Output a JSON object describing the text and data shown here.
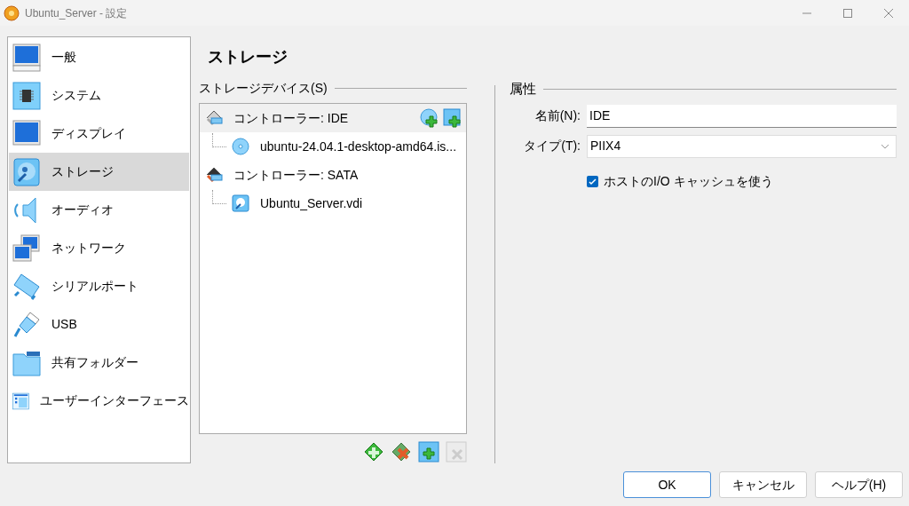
{
  "window": {
    "title": "Ubuntu_Server - 設定"
  },
  "sidebar": {
    "items": [
      {
        "label": "一般",
        "kind": "general",
        "selected": false
      },
      {
        "label": "システム",
        "kind": "system",
        "selected": false
      },
      {
        "label": "ディスプレイ",
        "kind": "display",
        "selected": false
      },
      {
        "label": "ストレージ",
        "kind": "storage",
        "selected": true
      },
      {
        "label": "オーディオ",
        "kind": "audio",
        "selected": false
      },
      {
        "label": "ネットワーク",
        "kind": "network",
        "selected": false
      },
      {
        "label": "シリアルポート",
        "kind": "serial",
        "selected": false
      },
      {
        "label": "USB",
        "kind": "usb",
        "selected": false
      },
      {
        "label": "共有フォルダー",
        "kind": "folder",
        "selected": false
      },
      {
        "label": "ユーザーインターフェース",
        "kind": "ui",
        "selected": false
      }
    ]
  },
  "page": {
    "title": "ストレージ"
  },
  "storage": {
    "group_label": "ストレージデバイス(S)",
    "tree": [
      {
        "kind": "controller",
        "label": "コントローラー: IDE",
        "selected": true,
        "children": [
          {
            "kind": "optical",
            "label": "ubuntu-24.04.1-desktop-amd64.is...",
            "selected": false
          }
        ]
      },
      {
        "kind": "controller",
        "label": "コントローラー: SATA",
        "selected": false,
        "children": [
          {
            "kind": "disk",
            "label": "Ubuntu_Server.vdi",
            "selected": false
          }
        ]
      }
    ]
  },
  "properties": {
    "group_label": "属性",
    "name": {
      "label": "名前(N):",
      "value": "IDE"
    },
    "type": {
      "label": "タイプ(T):",
      "value": "PIIX4"
    },
    "cache": {
      "label": "ホストのI/O キャッシュを使う",
      "checked": true
    }
  },
  "buttons": [
    {
      "label": "OK",
      "default": true
    },
    {
      "label": "キャンセル",
      "default": false
    },
    {
      "label": "ヘルプ(H)",
      "default": false
    }
  ]
}
